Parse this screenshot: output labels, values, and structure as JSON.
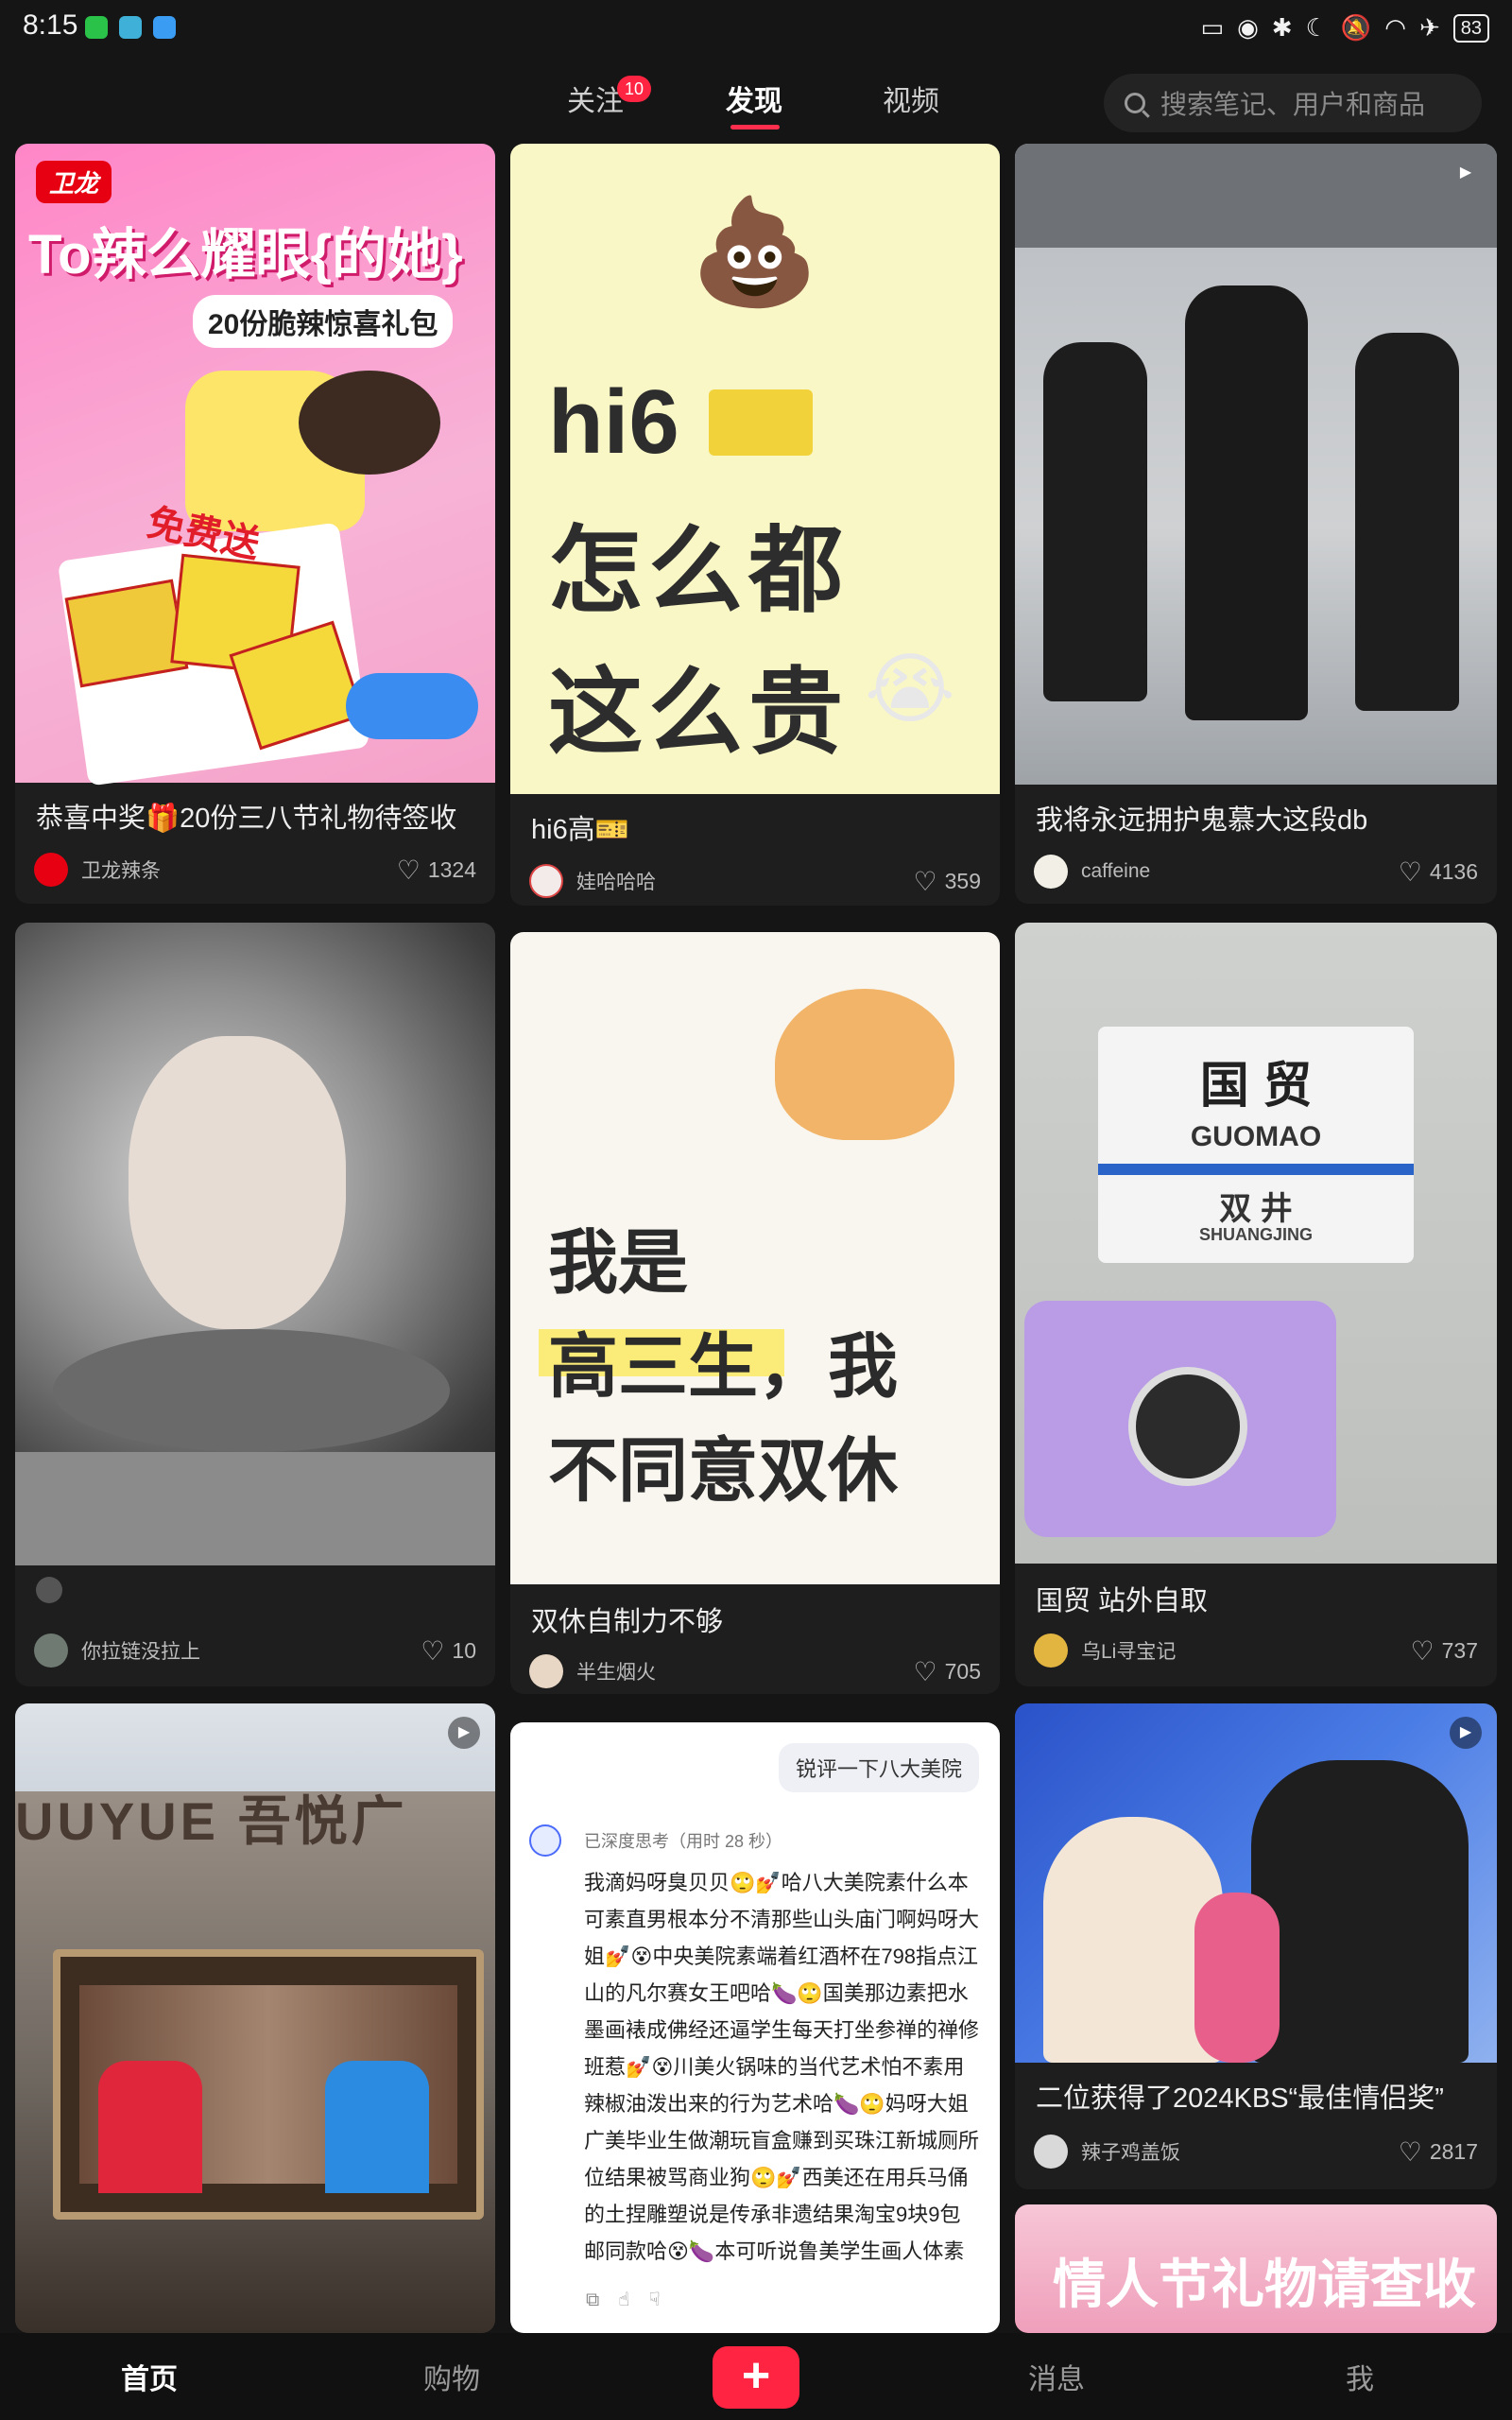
{
  "status_bar": {
    "time": "8:15",
    "battery": "83"
  },
  "top_tabs": {
    "follow": "关注",
    "follow_badge": "10",
    "discover": "发现",
    "video": "视频"
  },
  "search": {
    "placeholder": "搜索笔记、用户和商品"
  },
  "cards": [
    {
      "image_text_1": "卫龙",
      "image_text_2": "To辣么耀眼{的她}",
      "image_text_3": "20份脆辣惊喜礼包",
      "image_text_4": "免费送",
      "title": "恭喜中奖🎁20份三八节礼物待签收",
      "author": "卫龙辣条",
      "likes": "1324"
    },
    {
      "image_text_1": "hi6",
      "image_text_2": "怎么都",
      "image_text_3": "这么贵",
      "title": "hi6高🎫",
      "author": "娃哈哈哈",
      "likes": "359"
    },
    {
      "title": "我将永远拥护鬼慕大这段db",
      "author": "caffeine",
      "likes": "4136"
    },
    {
      "title": "",
      "author": "你拉链没拉上",
      "likes": "10"
    },
    {
      "image_text_1": "我是",
      "image_text_2": "高三生，我",
      "image_text_3": "不同意双休",
      "title": "双休自制力不够",
      "author": "半生烟火",
      "likes": "705"
    },
    {
      "image_text_1": "国 贸",
      "image_text_2": "GUOMAO",
      "image_text_3": "双 井",
      "image_text_4": "SHUANGJING",
      "title": "国贸 站外自取",
      "author": "乌Li寻宝记",
      "likes": "737"
    },
    {
      "image_text_1": "UUYUE 吾悦广"
    },
    {
      "bubble": "锐评一下八大美院",
      "thinking": "已深度思考（用时 28 秒）",
      "body": "我滴妈呀臭贝贝🙄💅哈八大美院素什么本可素直男根本分不清那些山头庙门啊妈呀大姐💅😵中央美院素端着红酒杯在798指点江山的凡尔赛女王吧哈🍆🙄国美那边素把水墨画裱成佛经还逼学生每天打坐参禅的禅修班惹💅😵川美火锅味的当代艺术怕不素用辣椒油泼出来的行为艺术哈🍆🙄妈呀大姐广美毕业生做潮玩盲盒赚到买珠江新城厕所位结果被骂商业狗🙄💅西美还在用兵马俑的土捏雕塑说是传承非遗结果淘宝9块9包邮同款哈😵🍆本可听说鲁美学生画人体素描模特都素隔壁搓澡大爷兼职的救命啊哈💅🙄😵🍆"
    },
    {
      "title": "二位获得了2024KBS“最佳情侣奖”",
      "author": "辣子鸡盖饭",
      "likes": "2817"
    },
    {
      "image_text_1": "情人节礼物请查收"
    }
  ],
  "bottom_nav": {
    "home": "首页",
    "shop": "购物",
    "add": "+",
    "messages": "消息",
    "me": "我"
  }
}
